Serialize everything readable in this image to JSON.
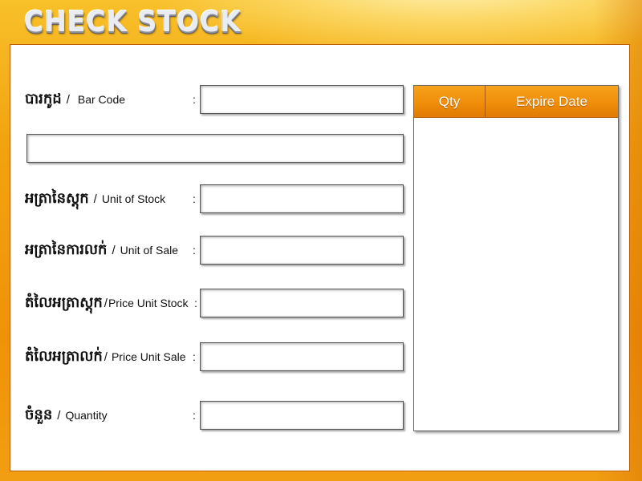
{
  "header": {
    "title": "CHECK STOCK"
  },
  "form": {
    "fields": [
      {
        "kh": "បារកូដ",
        "en": "Bar Code",
        "value": ""
      },
      {
        "kh": "អត្រានៃស្តុក",
        "en": "Unit of Stock",
        "value": ""
      },
      {
        "kh": "អត្រានៃការលក់",
        "en": "Unit of Sale",
        "value": ""
      },
      {
        "kh": "តំលៃអត្រាស្តុក",
        "en": "Price Unit Stock",
        "value": ""
      },
      {
        "kh": "តំលៃអត្រាលក់",
        "en": "Price Unit Sale",
        "value": ""
      },
      {
        "kh": "ចំនួន",
        "en": "Quantity",
        "value": ""
      }
    ],
    "description_value": "",
    "separator": "/",
    "colon": ":"
  },
  "grid": {
    "columns": [
      "Qty",
      "Expire Date"
    ],
    "rows": []
  },
  "colors": {
    "accent_orange": "#f08e0a",
    "frame_yellow": "#f5b21a",
    "panel_border": "#c05f00"
  }
}
